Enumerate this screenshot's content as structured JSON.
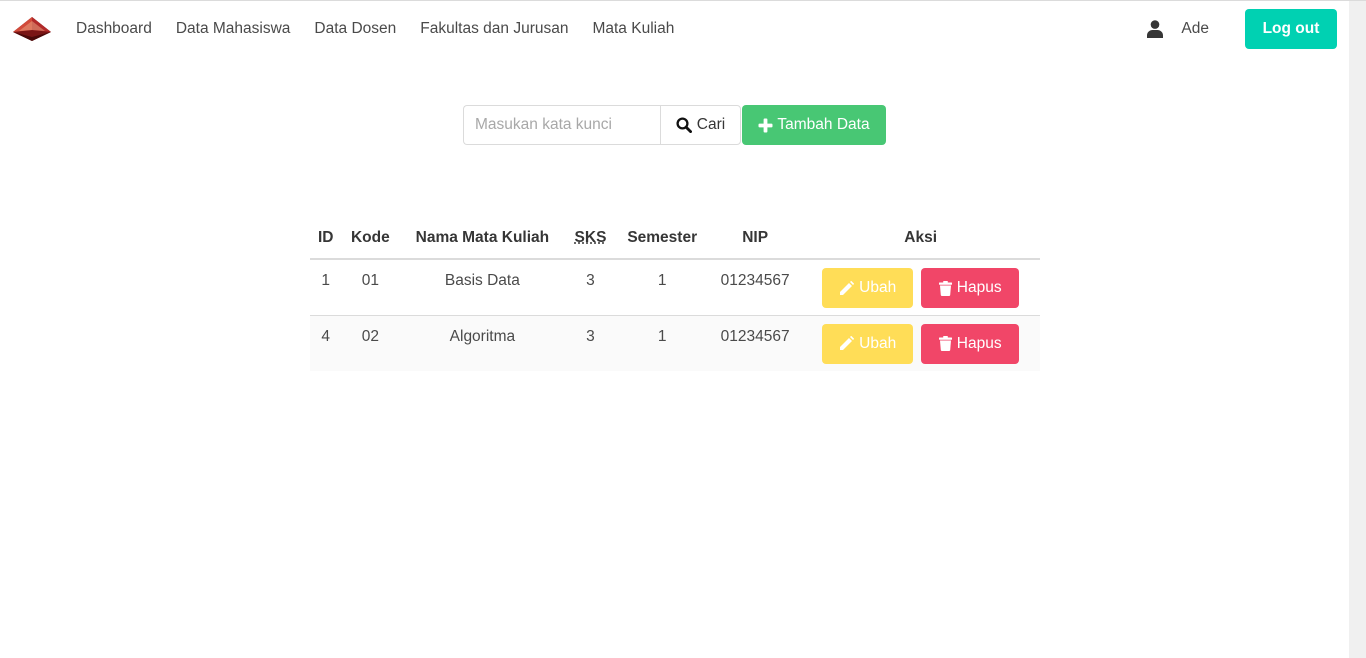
{
  "navbar": {
    "brand_icon": "pyramid-logo-icon",
    "items": [
      {
        "label": "Dashboard"
      },
      {
        "label": "Data Mahasiswa"
      },
      {
        "label": "Data Dosen"
      },
      {
        "label": "Fakultas dan Jurusan"
      },
      {
        "label": "Mata Kuliah"
      }
    ],
    "user_icon": "user-icon",
    "user_name": "Ade",
    "logout_label": "Log out",
    "accent_color": "#00d1b2"
  },
  "search": {
    "placeholder": "Masukan kata kunci",
    "value": "",
    "button_label": "Cari",
    "button_icon": "search-icon"
  },
  "add_button": {
    "label": "Tambah Data",
    "icon": "plus-icon",
    "color": "#48c774"
  },
  "table": {
    "headers": [
      "ID",
      "Kode",
      "Nama Mata Kuliah",
      "SKS",
      "Semester",
      "NIP",
      "Aksi"
    ],
    "rows": [
      {
        "id": "1",
        "kode": "01",
        "nama": "Basis Data",
        "sks": "3",
        "semester": "1",
        "nip": "01234567"
      },
      {
        "id": "4",
        "kode": "02",
        "nama": "Algoritma",
        "sks": "3",
        "semester": "1",
        "nip": "01234567"
      }
    ],
    "edit_label": "Ubah",
    "edit_icon": "pencil-icon",
    "edit_color": "#ffdd57",
    "delete_label": "Hapus",
    "delete_icon": "trash-icon",
    "delete_color": "#f14668"
  }
}
